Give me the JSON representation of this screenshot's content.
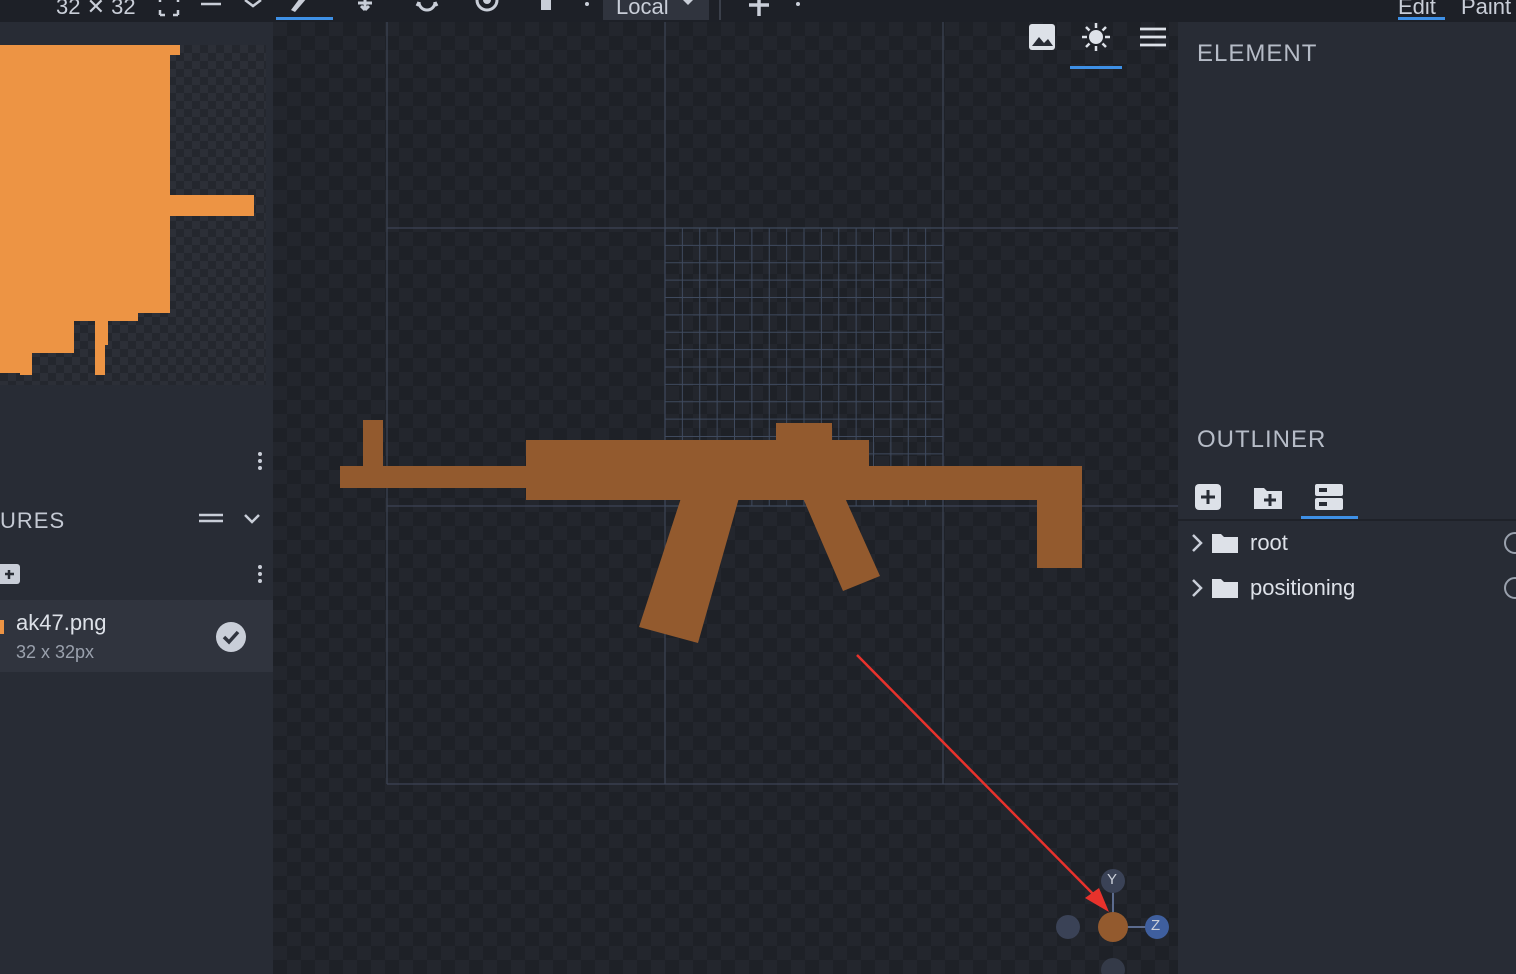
{
  "toolbar": {
    "resolution": "32 ✕ 32",
    "transform_space": "Local",
    "tabs": [
      "Edit",
      "Paint"
    ],
    "active_tab": "Edit",
    "icons": [
      "fullscreen-icon",
      "menu-icon",
      "chevron-down-icon",
      "brush-icon",
      "move-icon",
      "rotate-icon",
      "pivot-icon",
      "resize-icon",
      "add-icon"
    ]
  },
  "left_panel": {
    "section_title": "URES",
    "texture": {
      "name": "ak47.png",
      "size": "32 x 32px",
      "status_icon": "check-circle-icon"
    },
    "preview_color": "#ed9444"
  },
  "viewport": {
    "buttons": [
      "image-icon",
      "brightness-icon",
      "menu-icon"
    ],
    "model_color": "#935a2e",
    "gizmo_labels": {
      "y": "Y",
      "z": "Z"
    },
    "annotation": "red-arrow-icon"
  },
  "right_panel": {
    "element_title": "ELEMENT",
    "outliner_title": "OUTLINER",
    "outliner_tools": [
      "add-cube-icon",
      "add-group-icon",
      "toggle-options-icon"
    ],
    "items": [
      {
        "name": "root",
        "icon": "folder-icon"
      },
      {
        "name": "positioning",
        "icon": "folder-icon"
      }
    ]
  },
  "colors": {
    "accent": "#3e90e6",
    "panel": "#282c35",
    "viewport": "#1d2027",
    "model": "#935a2e",
    "texture": "#ed9444",
    "arrow": "#e8322c"
  }
}
